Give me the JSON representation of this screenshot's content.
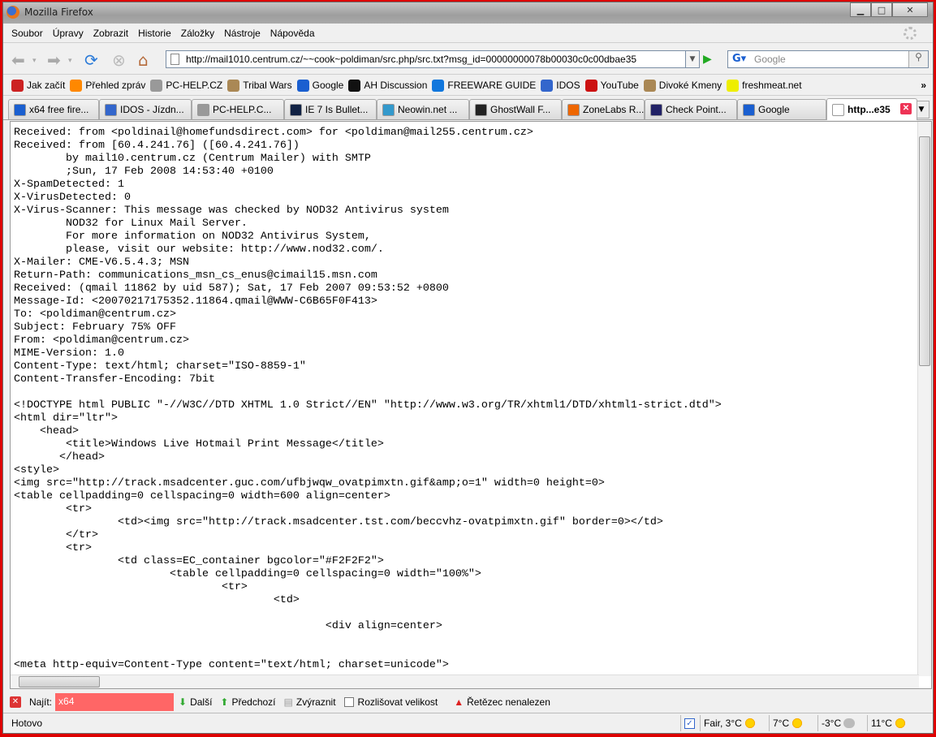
{
  "window": {
    "title": "Mozilla Firefox"
  },
  "menu": [
    "Soubor",
    "Úpravy",
    "Zobrazit",
    "Historie",
    "Záložky",
    "Nástroje",
    "Nápověda"
  ],
  "nav": {
    "url": "http://mail1010.centrum.cz/~~cook~poldiman/src.php/src.txt?msg_id=00000000078b00030c0c00dbae35",
    "search_placeholder": "Google"
  },
  "bookmarks": [
    {
      "label": "Jak začít",
      "color": "#c22"
    },
    {
      "label": "Přehled zpráv",
      "color": "#f80"
    },
    {
      "label": "PC-HELP.CZ",
      "color": "#999"
    },
    {
      "label": "Tribal Wars",
      "color": "#a85"
    },
    {
      "label": "Google",
      "color": "#1a5fd0"
    },
    {
      "label": "AH Discussion",
      "color": "#111"
    },
    {
      "label": "FREEWARE GUIDE",
      "color": "#17d"
    },
    {
      "label": "IDOS",
      "color": "#36c"
    },
    {
      "label": "YouTube",
      "color": "#c11"
    },
    {
      "label": "Divoké Kmeny",
      "color": "#a85"
    },
    {
      "label": "freshmeat.net",
      "color": "#ee0"
    }
  ],
  "bookmarks_more": "»",
  "tabs": [
    {
      "label": "x64 free fire...",
      "color": "#1a5fd0"
    },
    {
      "label": "IDOS - Jízdn...",
      "color": "#36c"
    },
    {
      "label": "PC-HELP.C...",
      "color": "#999"
    },
    {
      "label": "IE 7 Is Bullet...",
      "color": "#124"
    },
    {
      "label": "Neowin.net ...",
      "color": "#39c"
    },
    {
      "label": "GhostWall F...",
      "color": "#222"
    },
    {
      "label": "ZoneLabs R...",
      "color": "#e60"
    },
    {
      "label": "Check Point...",
      "color": "#226"
    },
    {
      "label": "Google",
      "color": "#1a5fd0"
    },
    {
      "label": "http...e35",
      "color": "#fff",
      "active": true
    }
  ],
  "source_lines": [
    "Received: from <poldinail@homefundsdirect.com> for <poldiman@mail255.centrum.cz>",
    "Received: from [60.4.241.76] ([60.4.241.76])",
    "        by mail10.centrum.cz (Centrum Mailer) with SMTP",
    "        ;Sun, 17 Feb 2008 14:53:40 +0100",
    "X-SpamDetected: 1",
    "X-VirusDetected: 0",
    "X-Virus-Scanner: This message was checked by NOD32 Antivirus system",
    "        NOD32 for Linux Mail Server.",
    "        For more information on NOD32 Antivirus System,",
    "        please, visit our website: http://www.nod32.com/.",
    "X-Mailer: CME-V6.5.4.3; MSN",
    "Return-Path: communications_msn_cs_enus@cimail15.msn.com",
    "Received: (qmail 11862 by uid 587); Sat, 17 Feb 2007 09:53:52 +0800",
    "Message-Id: <20070217175352.11864.qmail@WWW-C6B65F0F413>",
    "To: <poldiman@centrum.cz>",
    "Subject: February 75% OFF",
    "From: <poldiman@centrum.cz>",
    "MIME-Version: 1.0",
    "Content-Type: text/html; charset=\"ISO-8859-1\"",
    "Content-Transfer-Encoding: 7bit",
    "",
    "<!DOCTYPE html PUBLIC \"-//W3C//DTD XHTML 1.0 Strict//EN\" \"http://www.w3.org/TR/xhtml1/DTD/xhtml1-strict.dtd\">",
    "<html dir=\"ltr\">",
    "    <head>",
    "        <title>Windows Live Hotmail Print Message</title>",
    "       </head>",
    "<style>",
    "<img src=\"http://track.msadcenter.guc.com/ufbjwqw_ovatpimxtn.gif&amp;o=1\" width=0 height=0>",
    "<table cellpadding=0 cellspacing=0 width=600 align=center>",
    "        <tr>",
    "                <td><img src=\"http://track.msadcenter.tst.com/beccvhz-ovatpimxtn.gif\" border=0></td>",
    "        </tr>",
    "        <tr>",
    "                <td class=EC_container bgcolor=\"#F2F2F2\">",
    "                        <table cellpadding=0 cellspacing=0 width=\"100%\">",
    "                                <tr>",
    "                                        <td>",
    "",
    "                                                <div align=center>",
    "",
    "",
    "<meta http-equiv=Content-Type content=\"text/html; charset=unicode\">"
  ],
  "findbar": {
    "label": "Najít:",
    "value": "x64",
    "next": "Další",
    "prev": "Předchozí",
    "highlight": "Zvýraznit",
    "match_case": "Rozlišovat velikost",
    "match_case_checked": false,
    "status": "Řetězec nenalezen"
  },
  "statusbar": {
    "text": "Hotovo",
    "weather": [
      {
        "text": "Fair, 3°C",
        "icon": "sun"
      },
      {
        "text": "7°C",
        "icon": "sun"
      },
      {
        "text": "-3°C",
        "icon": "cloud"
      },
      {
        "text": "11°C",
        "icon": "sun"
      }
    ]
  }
}
